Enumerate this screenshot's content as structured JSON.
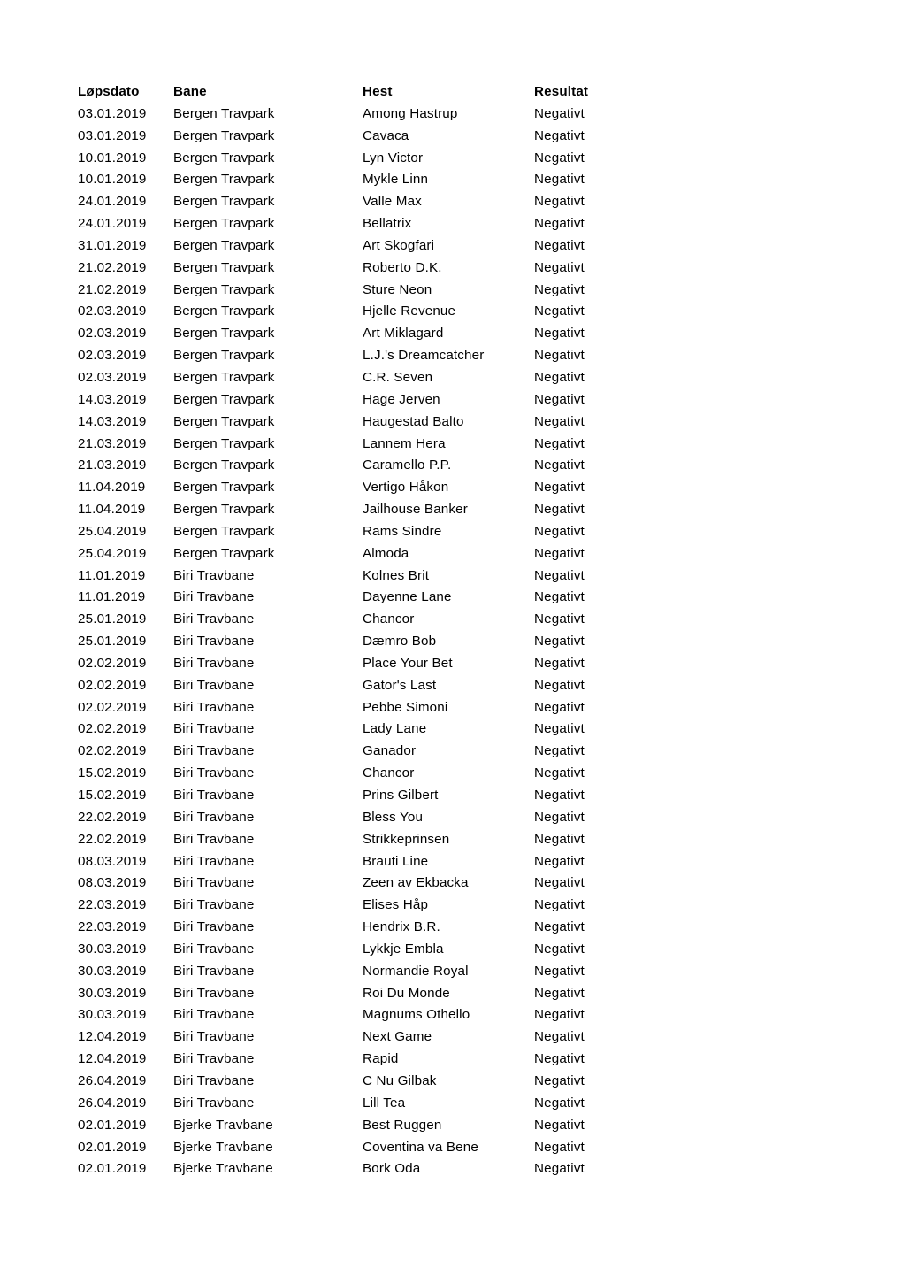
{
  "document": {
    "background_color": "#ffffff",
    "text_color": "#000000"
  },
  "table": {
    "headers": {
      "dato": "Løpsdato",
      "bane": "Bane",
      "hest": "Hest",
      "resultat": "Resultat"
    },
    "columns": [
      "Løpsdato",
      "Bane",
      "Hest",
      "Resultat"
    ],
    "rows": [
      [
        "03.01.2019",
        "Bergen Travpark",
        "Among Hastrup",
        "Negativt"
      ],
      [
        "03.01.2019",
        "Bergen Travpark",
        "Cavaca",
        "Negativt"
      ],
      [
        "10.01.2019",
        "Bergen Travpark",
        "Lyn Victor",
        "Negativt"
      ],
      [
        "10.01.2019",
        "Bergen Travpark",
        "Mykle Linn",
        "Negativt"
      ],
      [
        "24.01.2019",
        "Bergen Travpark",
        "Valle Max",
        "Negativt"
      ],
      [
        "24.01.2019",
        "Bergen Travpark",
        "Bellatrix",
        "Negativt"
      ],
      [
        "31.01.2019",
        "Bergen Travpark",
        "Art Skogfari",
        "Negativt"
      ],
      [
        "21.02.2019",
        "Bergen Travpark",
        "Roberto D.K.",
        "Negativt"
      ],
      [
        "21.02.2019",
        "Bergen Travpark",
        "Sture Neon",
        "Negativt"
      ],
      [
        "02.03.2019",
        "Bergen Travpark",
        "Hjelle Revenue",
        "Negativt"
      ],
      [
        "02.03.2019",
        "Bergen Travpark",
        "Art Miklagard",
        "Negativt"
      ],
      [
        "02.03.2019",
        "Bergen Travpark",
        "L.J.'s Dreamcatcher",
        "Negativt"
      ],
      [
        "02.03.2019",
        "Bergen Travpark",
        "C.R. Seven",
        "Negativt"
      ],
      [
        "14.03.2019",
        "Bergen Travpark",
        "Hage Jerven",
        "Negativt"
      ],
      [
        "14.03.2019",
        "Bergen Travpark",
        "Haugestad Balto",
        "Negativt"
      ],
      [
        "21.03.2019",
        "Bergen Travpark",
        "Lannem Hera",
        "Negativt"
      ],
      [
        "21.03.2019",
        "Bergen Travpark",
        "Caramello P.P.",
        "Negativt"
      ],
      [
        "11.04.2019",
        "Bergen Travpark",
        "Vertigo Håkon",
        "Negativt"
      ],
      [
        "11.04.2019",
        "Bergen Travpark",
        "Jailhouse Banker",
        "Negativt"
      ],
      [
        "25.04.2019",
        "Bergen Travpark",
        "Rams Sindre",
        "Negativt"
      ],
      [
        "25.04.2019",
        "Bergen Travpark",
        "Almoda",
        "Negativt"
      ],
      [
        "11.01.2019",
        "Biri Travbane",
        "Kolnes Brit",
        "Negativt"
      ],
      [
        "11.01.2019",
        "Biri Travbane",
        "Dayenne Lane",
        "Negativt"
      ],
      [
        "25.01.2019",
        "Biri Travbane",
        "Chancor",
        "Negativt"
      ],
      [
        "25.01.2019",
        "Biri Travbane",
        "Dæmro Bob",
        "Negativt"
      ],
      [
        "02.02.2019",
        "Biri Travbane",
        "Place Your Bet",
        "Negativt"
      ],
      [
        "02.02.2019",
        "Biri Travbane",
        "Gator's Last",
        "Negativt"
      ],
      [
        "02.02.2019",
        "Biri Travbane",
        "Pebbe Simoni",
        "Negativt"
      ],
      [
        "02.02.2019",
        "Biri Travbane",
        "Lady Lane",
        "Negativt"
      ],
      [
        "02.02.2019",
        "Biri Travbane",
        "Ganador",
        "Negativt"
      ],
      [
        "15.02.2019",
        "Biri Travbane",
        "Chancor",
        "Negativt"
      ],
      [
        "15.02.2019",
        "Biri Travbane",
        "Prins Gilbert",
        "Negativt"
      ],
      [
        "22.02.2019",
        "Biri Travbane",
        "Bless You",
        "Negativt"
      ],
      [
        "22.02.2019",
        "Biri Travbane",
        "Strikkeprinsen",
        "Negativt"
      ],
      [
        "08.03.2019",
        "Biri Travbane",
        "Brauti Line",
        "Negativt"
      ],
      [
        "08.03.2019",
        "Biri Travbane",
        "Zeen av Ekbacka",
        "Negativt"
      ],
      [
        "22.03.2019",
        "Biri Travbane",
        "Elises Håp",
        "Negativt"
      ],
      [
        "22.03.2019",
        "Biri Travbane",
        "Hendrix B.R.",
        "Negativt"
      ],
      [
        "30.03.2019",
        "Biri Travbane",
        "Lykkje Embla",
        "Negativt"
      ],
      [
        "30.03.2019",
        "Biri Travbane",
        "Normandie Royal",
        "Negativt"
      ],
      [
        "30.03.2019",
        "Biri Travbane",
        "Roi Du Monde",
        "Negativt"
      ],
      [
        "30.03.2019",
        "Biri Travbane",
        "Magnums Othello",
        "Negativt"
      ],
      [
        "12.04.2019",
        "Biri Travbane",
        "Next Game",
        "Negativt"
      ],
      [
        "12.04.2019",
        "Biri Travbane",
        "Rapid",
        "Negativt"
      ],
      [
        "26.04.2019",
        "Biri Travbane",
        "C Nu Gilbak",
        "Negativt"
      ],
      [
        "26.04.2019",
        "Biri Travbane",
        "Lill Tea",
        "Negativt"
      ],
      [
        "02.01.2019",
        "Bjerke Travbane",
        "Best Ruggen",
        "Negativt"
      ],
      [
        "02.01.2019",
        "Bjerke Travbane",
        "Coventina va Bene",
        "Negativt"
      ],
      [
        "02.01.2019",
        "Bjerke Travbane",
        "Bork Oda",
        "Negativt"
      ]
    ]
  }
}
